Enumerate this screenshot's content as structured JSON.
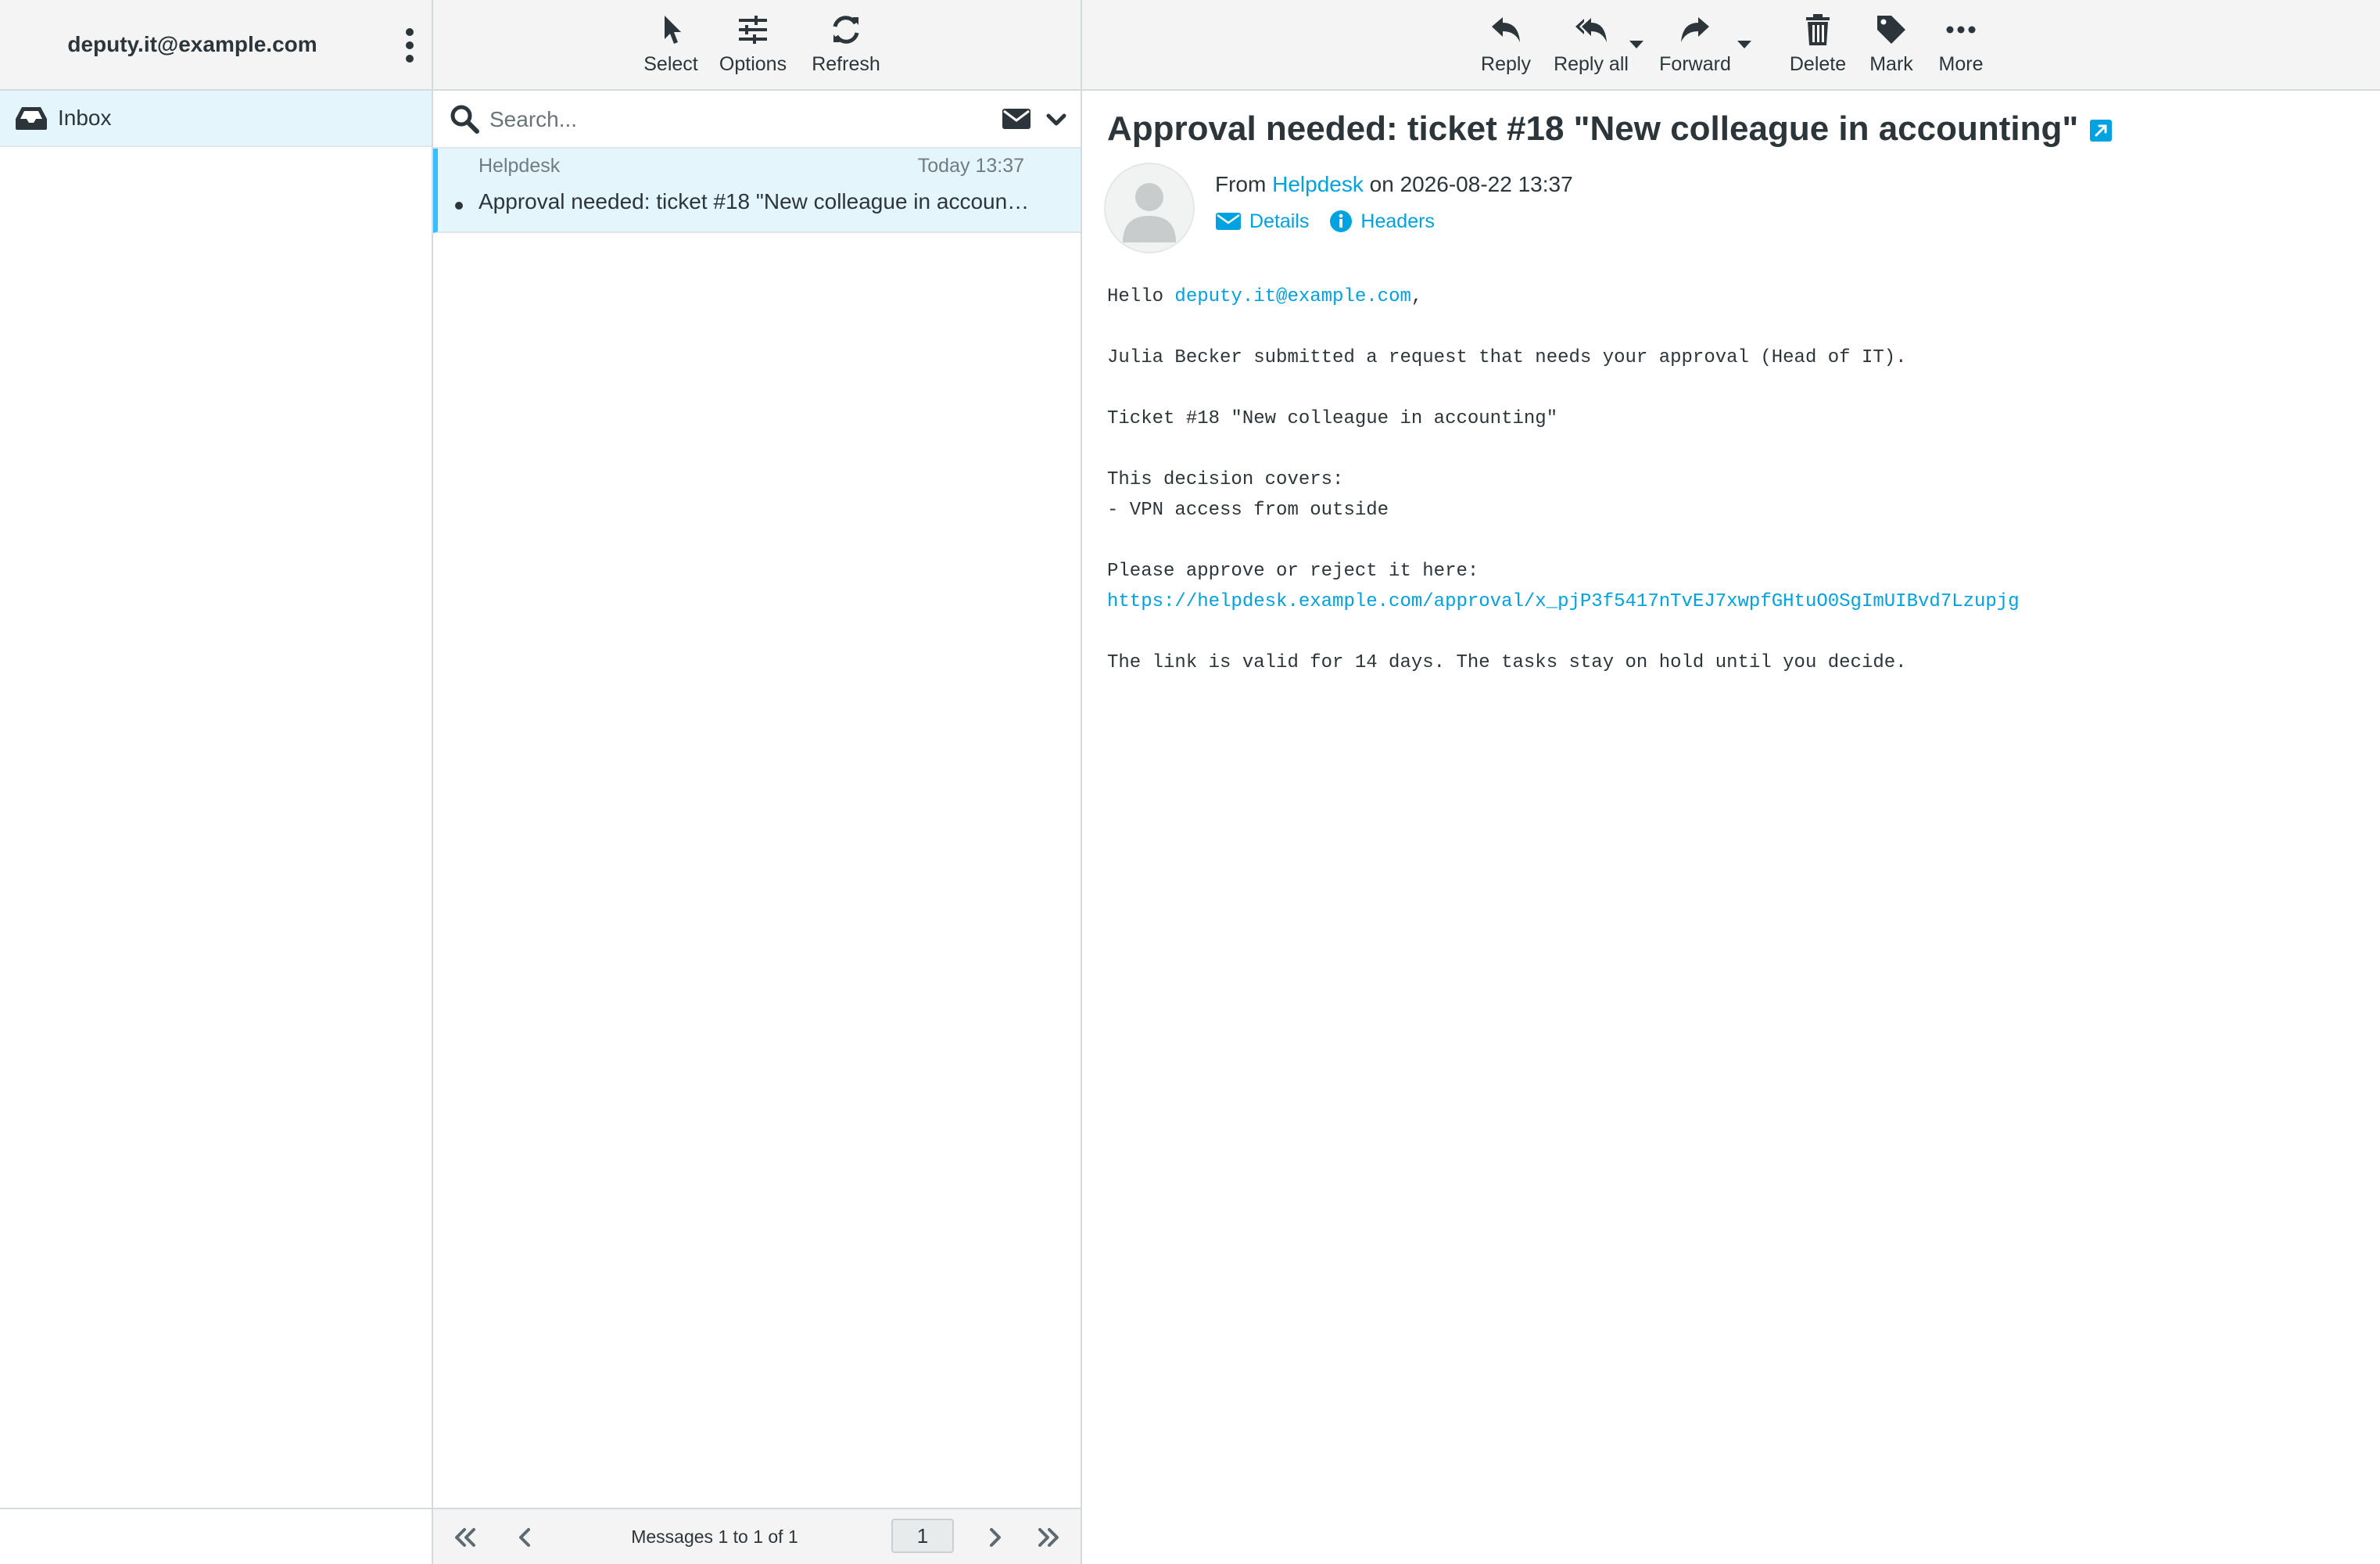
{
  "account": {
    "email": "deputy.it@example.com"
  },
  "folders": [
    {
      "label": "Inbox",
      "icon": "inbox-icon"
    }
  ],
  "list_toolbar": {
    "select": "Select",
    "options": "Options",
    "refresh": "Refresh"
  },
  "search": {
    "placeholder": "Search..."
  },
  "messages": [
    {
      "from": "Helpdesk",
      "date": "Today 13:37",
      "subject": "Approval needed: ticket #18 \"New colleague in accounting\"",
      "unread": true
    }
  ],
  "pagination": {
    "count_text": "Messages 1 to 1 of 1",
    "page": "1"
  },
  "message_toolbar": {
    "reply": "Reply",
    "reply_all": "Reply all",
    "forward": "Forward",
    "delete": "Delete",
    "mark": "Mark",
    "more": "More"
  },
  "message": {
    "subject": "Approval needed: ticket #18 \"New colleague in accounting\"",
    "from_prefix": "From",
    "from_name": "Helpdesk",
    "date_prefix": "on",
    "date": "2026-08-22 13:37",
    "details_label": "Details",
    "headers_label": "Headers",
    "body": {
      "greeting_prefix": "Hello ",
      "greeting_email": "deputy.it@example.com",
      "greeting_suffix": ",",
      "line1": "Julia Becker submitted a request that needs your approval (Head of IT).",
      "line2": "Ticket #18 \"New colleague in accounting\"",
      "line3": "This decision covers:",
      "line4": "- VPN access from outside",
      "line5": "Please approve or reject it here:",
      "link": "https://helpdesk.example.com/approval/x_pjP3f5417nTvEJ7xwpfGHtuO0SgImUIBvd7Lzupjg",
      "line6": "The link is valid for 14 days. The tasks stay on hold until you decide."
    }
  },
  "colors": {
    "accent": "#00a2e2",
    "selected_bg": "#e4f5fc",
    "text": "#2c363a"
  }
}
